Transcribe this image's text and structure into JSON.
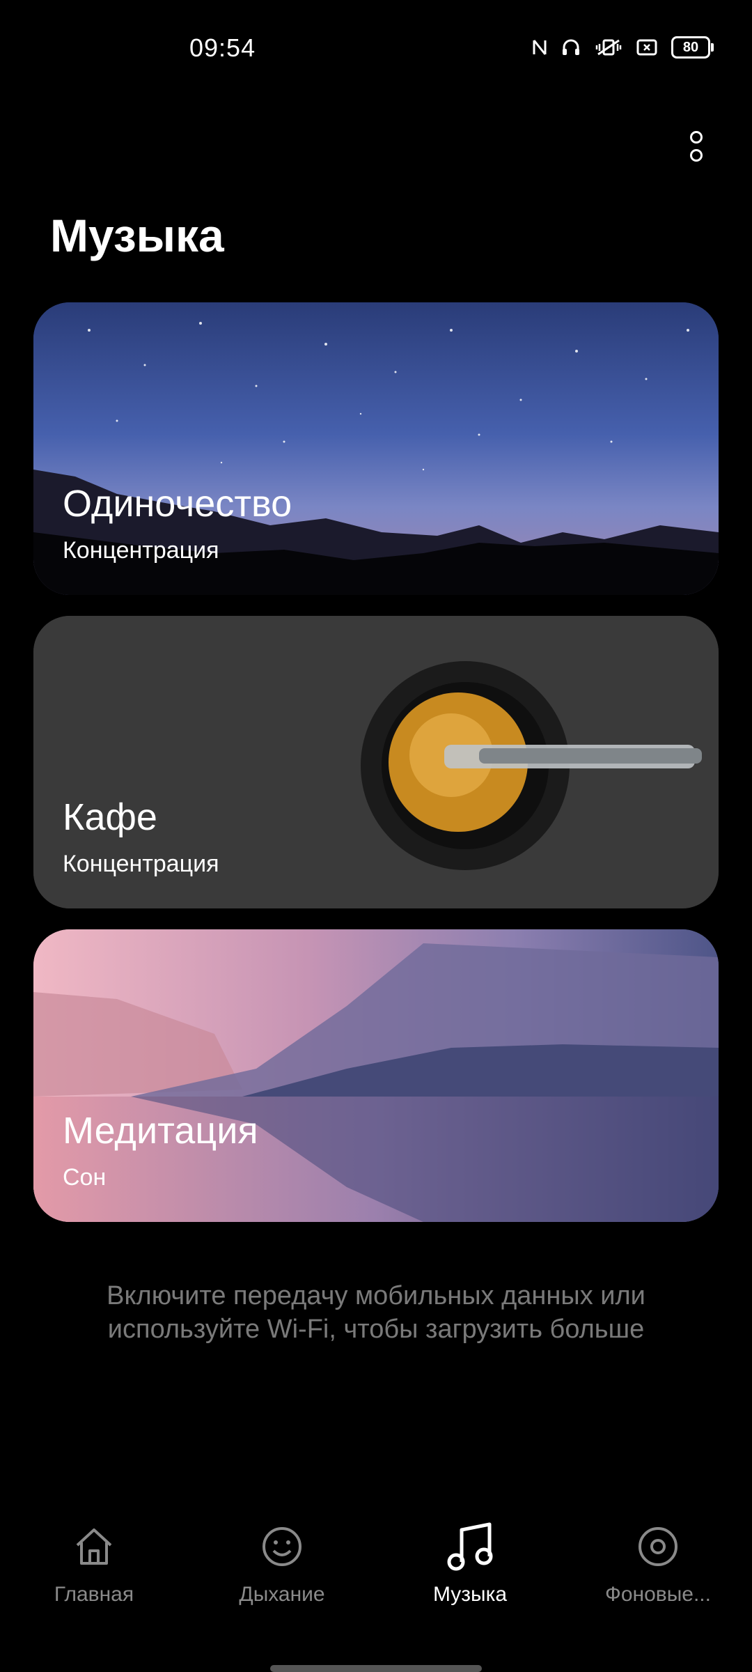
{
  "status": {
    "time": "09:54",
    "battery": "80",
    "icons": [
      "nfc-icon",
      "headphones-icon",
      "vibrate-icon",
      "screen-record-icon",
      "battery-icon"
    ]
  },
  "header": {
    "title": "Музыка",
    "menu_icon": "more-vertical-icon"
  },
  "cards": [
    {
      "title": "Одиночество",
      "subtitle": "Концентрация",
      "image": "night-sky-mountains"
    },
    {
      "title": "Кафе",
      "subtitle": "Концентрация",
      "image": "coffee-cup"
    },
    {
      "title": "Медитация",
      "subtitle": "Сон",
      "image": "misty-lake"
    }
  ],
  "info_message": {
    "line1": "Включите передачу мобильных данных или",
    "line2": "используйте Wi-Fi, чтобы загрузить больше"
  },
  "nav": {
    "items": [
      {
        "label": "Главная",
        "icon": "home-icon"
      },
      {
        "label": "Дыхание",
        "icon": "smile-icon"
      },
      {
        "label": "Музыка",
        "icon": "music-note-icon",
        "active": true
      },
      {
        "label": "Фоновые...",
        "icon": "disc-icon"
      }
    ]
  },
  "colors": {
    "background": "#000000",
    "muted_text": "#7a7a7a",
    "inactive_nav": "#8a8a8a"
  }
}
